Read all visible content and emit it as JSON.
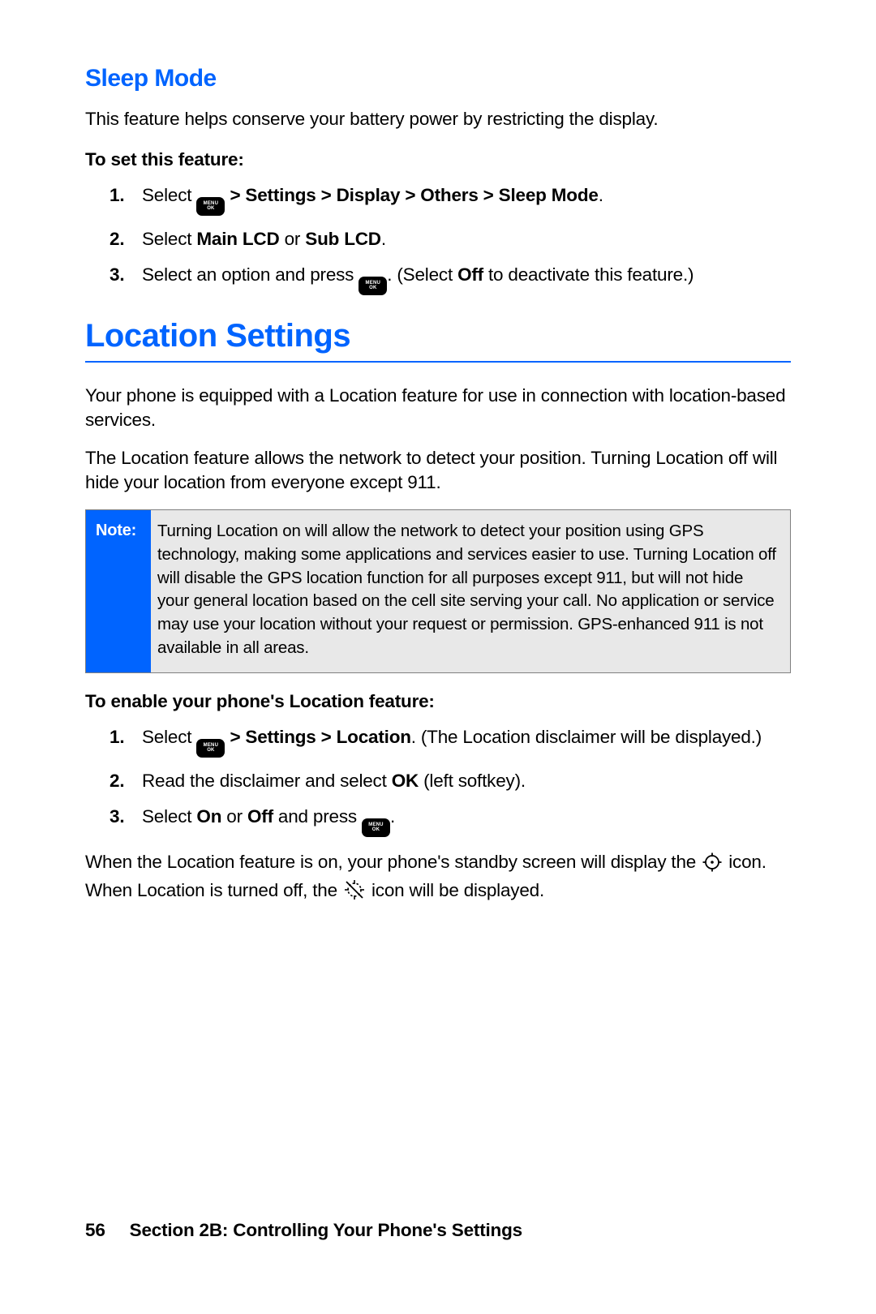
{
  "sleep": {
    "title": "Sleep Mode",
    "intro": "This feature helps conserve your battery power by restricting the display.",
    "sub": "To set this feature:",
    "steps": {
      "s1_a": "Select ",
      "s1_b": " > Settings > Display > Others > Sleep Mode",
      "s1_c": ".",
      "s2_a": "Select ",
      "s2_b": "Main LCD",
      "s2_c": " or ",
      "s2_d": "Sub LCD",
      "s2_e": ".",
      "s3_a": "Select an option and press ",
      "s3_b": ". (Select ",
      "s3_c": "Off",
      "s3_d": " to deactivate this feature.)"
    }
  },
  "location": {
    "title": "Location Settings",
    "p1": "Your phone is equipped with a Location feature for use in connection with location-based services.",
    "p2": "The Location feature allows the network to detect your position. Turning Location off will hide your location from everyone except 911.",
    "note_label": "Note:",
    "note_text": "Turning Location on will allow the network to detect your position using GPS technology, making some applications and services easier to use. Turning Location off will disable the GPS location function for all purposes except 911, but will not hide your general location based on the cell site serving your call. No application or service may use your location without your request or permission. GPS-enhanced 911 is not available in all areas.",
    "sub": "To enable your phone's Location feature:",
    "steps": {
      "s1_a": "Select ",
      "s1_b": " > Settings > Location",
      "s1_c": ". (The Location disclaimer will be displayed.)",
      "s2_a": "Read the disclaimer and select ",
      "s2_b": "OK",
      "s2_c": " (left softkey).",
      "s3_a": "Select ",
      "s3_b": "On",
      "s3_c": " or ",
      "s3_d": "Off",
      "s3_e": " and press ",
      "s3_f": "."
    },
    "trailer_a": "When the Location feature is on, your phone's standby screen will display the ",
    "trailer_b": " icon. When Location is turned off, the ",
    "trailer_c": " icon will be displayed."
  },
  "footer": {
    "page": "56",
    "section": "Section 2B: Controlling Your Phone's Settings"
  },
  "keys": {
    "menu_top": "MENU",
    "menu_bot": "OK"
  }
}
